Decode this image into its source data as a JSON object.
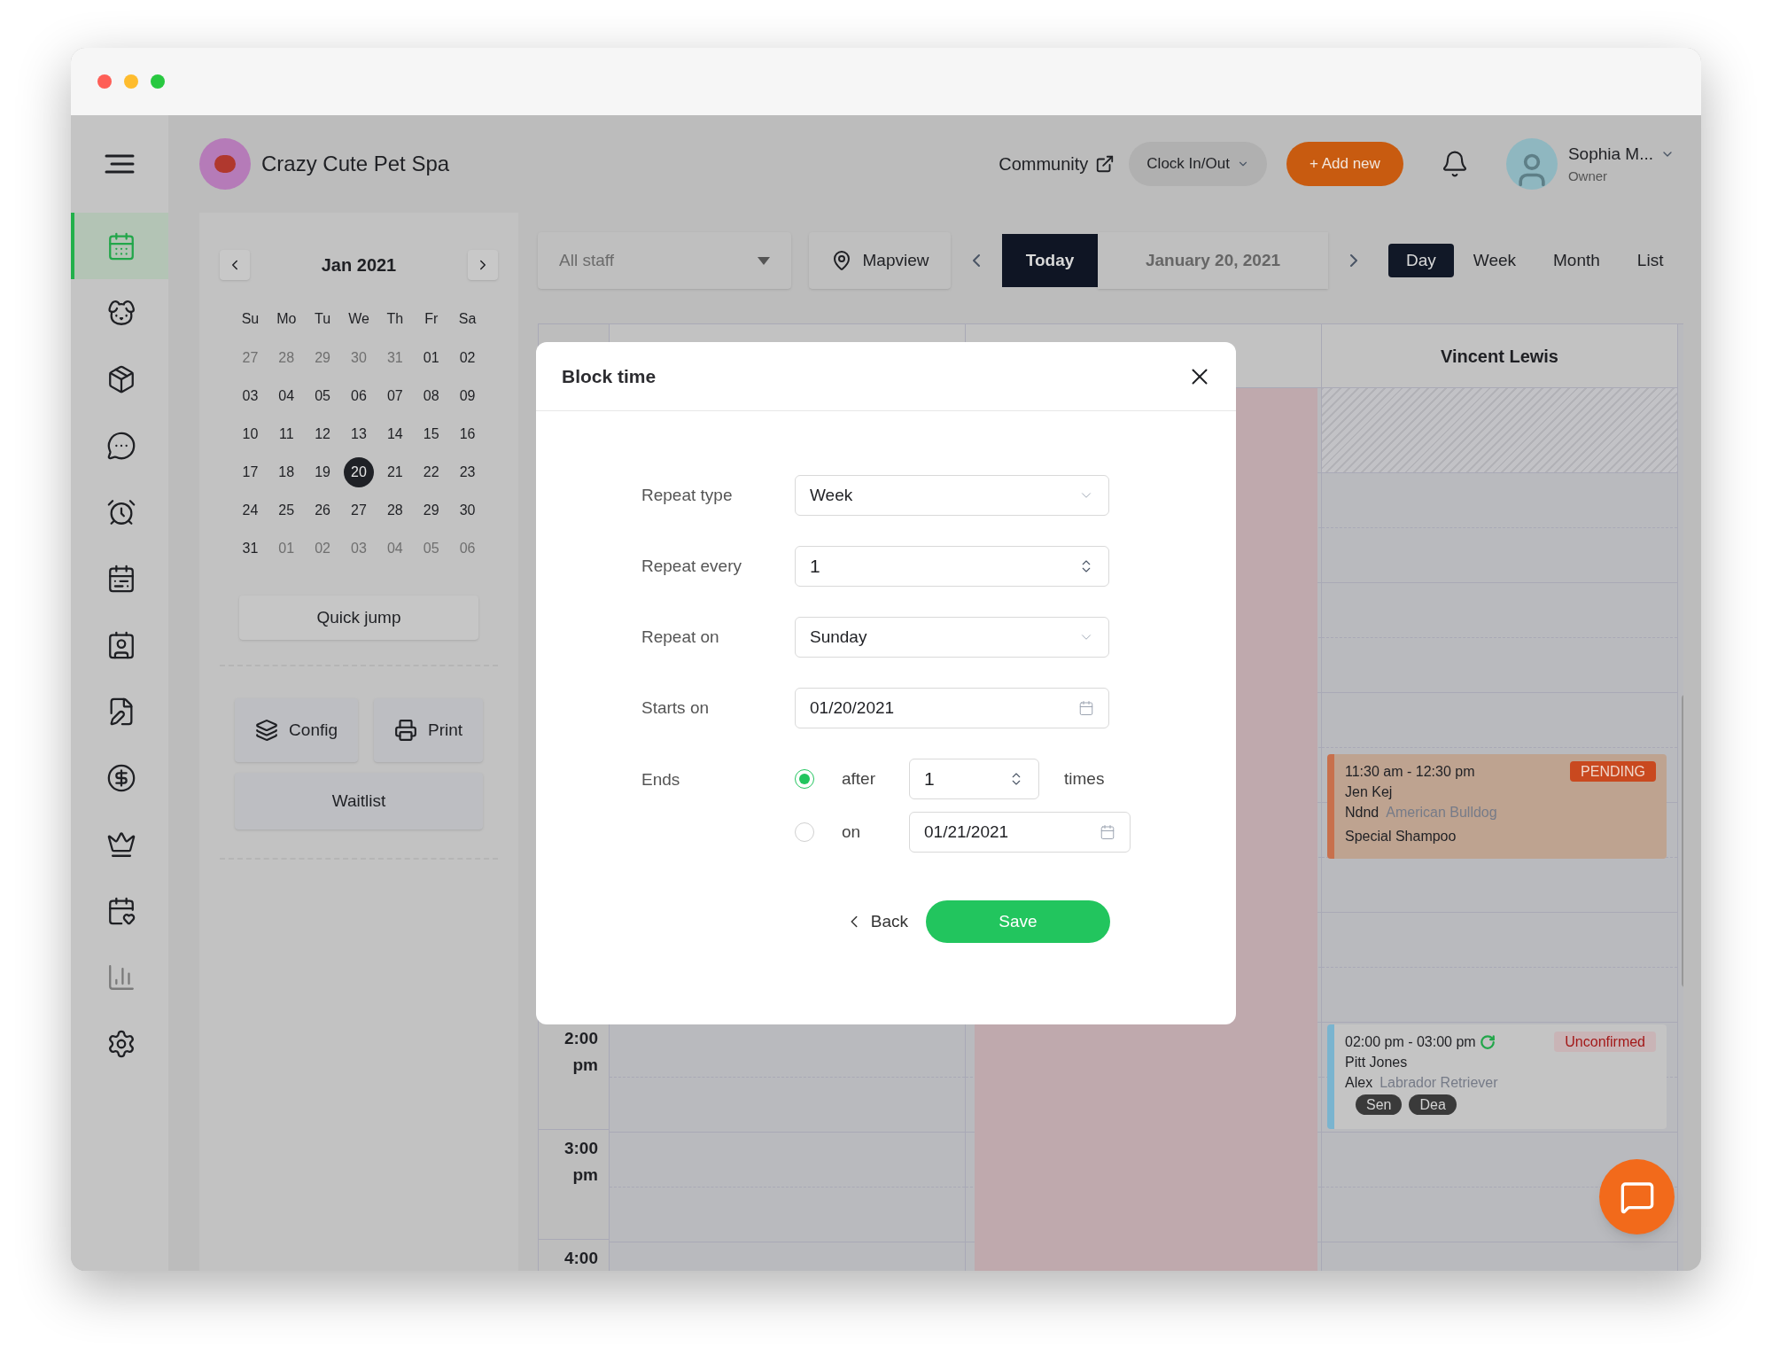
{
  "header": {
    "business_name": "Crazy Cute Pet Spa",
    "community_link": "Community",
    "clock_button": "Clock In/Out",
    "add_button": "+ Add new",
    "user": {
      "name": "Sophia M...",
      "role": "Owner"
    }
  },
  "sidebar": {
    "items": [
      {
        "selected": true,
        "disabled": false
      },
      {
        "selected": false,
        "disabled": false
      },
      {
        "selected": false,
        "disabled": false
      },
      {
        "selected": false,
        "disabled": false
      },
      {
        "selected": false,
        "disabled": false
      },
      {
        "selected": false,
        "disabled": false
      },
      {
        "selected": false,
        "disabled": false
      },
      {
        "selected": false,
        "disabled": false
      },
      {
        "selected": false,
        "disabled": false
      },
      {
        "selected": false,
        "disabled": false
      },
      {
        "selected": false,
        "disabled": false
      },
      {
        "selected": false,
        "disabled": true
      },
      {
        "selected": false,
        "disabled": false
      }
    ]
  },
  "mini_calendar": {
    "title": "Jan 2021",
    "weekdays": [
      "Su",
      "Mo",
      "Tu",
      "We",
      "Th",
      "Fr",
      "Sa"
    ],
    "weeks": [
      [
        {
          "label": "27",
          "in_month": false,
          "selected": false
        },
        {
          "label": "28",
          "in_month": false,
          "selected": false
        },
        {
          "label": "29",
          "in_month": false,
          "selected": false
        },
        {
          "label": "30",
          "in_month": false,
          "selected": false
        },
        {
          "label": "31",
          "in_month": false,
          "selected": false
        },
        {
          "label": "01",
          "in_month": true,
          "selected": false
        },
        {
          "label": "02",
          "in_month": true,
          "selected": false
        }
      ],
      [
        {
          "label": "03",
          "in_month": true,
          "selected": false
        },
        {
          "label": "04",
          "in_month": true,
          "selected": false
        },
        {
          "label": "05",
          "in_month": true,
          "selected": false
        },
        {
          "label": "06",
          "in_month": true,
          "selected": false
        },
        {
          "label": "07",
          "in_month": true,
          "selected": false
        },
        {
          "label": "08",
          "in_month": true,
          "selected": false
        },
        {
          "label": "09",
          "in_month": true,
          "selected": false
        }
      ],
      [
        {
          "label": "10",
          "in_month": true,
          "selected": false
        },
        {
          "label": "11",
          "in_month": true,
          "selected": false
        },
        {
          "label": "12",
          "in_month": true,
          "selected": false
        },
        {
          "label": "13",
          "in_month": true,
          "selected": false
        },
        {
          "label": "14",
          "in_month": true,
          "selected": false
        },
        {
          "label": "15",
          "in_month": true,
          "selected": false
        },
        {
          "label": "16",
          "in_month": true,
          "selected": false
        }
      ],
      [
        {
          "label": "17",
          "in_month": true,
          "selected": false
        },
        {
          "label": "18",
          "in_month": true,
          "selected": false
        },
        {
          "label": "19",
          "in_month": true,
          "selected": false
        },
        {
          "label": "20",
          "in_month": true,
          "selected": true
        },
        {
          "label": "21",
          "in_month": true,
          "selected": false
        },
        {
          "label": "22",
          "in_month": true,
          "selected": false
        },
        {
          "label": "23",
          "in_month": true,
          "selected": false
        }
      ],
      [
        {
          "label": "24",
          "in_month": true,
          "selected": false
        },
        {
          "label": "25",
          "in_month": true,
          "selected": false
        },
        {
          "label": "26",
          "in_month": true,
          "selected": false
        },
        {
          "label": "27",
          "in_month": true,
          "selected": false
        },
        {
          "label": "28",
          "in_month": true,
          "selected": false
        },
        {
          "label": "29",
          "in_month": true,
          "selected": false
        },
        {
          "label": "30",
          "in_month": true,
          "selected": false
        }
      ],
      [
        {
          "label": "31",
          "in_month": true,
          "selected": false
        },
        {
          "label": "01",
          "in_month": false,
          "selected": false
        },
        {
          "label": "02",
          "in_month": false,
          "selected": false
        },
        {
          "label": "03",
          "in_month": false,
          "selected": false
        },
        {
          "label": "04",
          "in_month": false,
          "selected": false
        },
        {
          "label": "05",
          "in_month": false,
          "selected": false
        },
        {
          "label": "06",
          "in_month": false,
          "selected": false
        }
      ]
    ],
    "quick_jump": "Quick jump",
    "config": "Config",
    "print": "Print",
    "waitlist": "Waitlist"
  },
  "toolbar": {
    "staff_select": "All staff",
    "mapview": "Mapview",
    "today": "Today",
    "date": "January 20, 2021",
    "views": [
      {
        "label": "Day",
        "selected": true
      },
      {
        "label": "Week",
        "selected": false
      },
      {
        "label": "Month",
        "selected": false
      },
      {
        "label": "List",
        "selected": false
      }
    ]
  },
  "calendar": {
    "columns": [
      {
        "blocked": false
      },
      {
        "blocked": true
      },
      {
        "name": "Vincent Lewis",
        "blocked": false
      }
    ],
    "time_labels": [
      {
        "hour": "2:00",
        "period": "pm"
      },
      {
        "hour": "3:00",
        "period": "pm"
      },
      {
        "hour": "4:00"
      }
    ],
    "appointments": [
      {
        "time": "11:30 am - 12:30 pm",
        "status": "PENDING",
        "kind": "pending",
        "repeat": false,
        "client": "Jen Kej",
        "pet": "Ndnd",
        "breed": "American Bulldog",
        "service": "Special Shampoo"
      },
      {
        "time": "02:00 pm - 03:00 pm",
        "status": "Unconfirmed",
        "kind": "unconfirmed",
        "repeat": true,
        "client": "Pitt Jones",
        "pet": "Alex",
        "breed": "Labrador Retriever",
        "tags": [
          "Sen",
          "Dea"
        ]
      }
    ]
  },
  "modal": {
    "title": "Block time",
    "fields": [
      {
        "kind": "select",
        "label": "Repeat type",
        "value": "Week"
      },
      {
        "kind": "number",
        "label": "Repeat every",
        "value": "1"
      },
      {
        "kind": "select",
        "label": "Repeat on",
        "value": "Sunday"
      },
      {
        "kind": "date",
        "label": "Starts on",
        "value": "01/20/2021"
      }
    ],
    "ends": {
      "label": "Ends",
      "options": [
        {
          "label": "after",
          "selected": true,
          "kind": "number",
          "value": "1",
          "suffix": "times"
        },
        {
          "label": "on",
          "selected": false,
          "kind": "date",
          "value": "01/21/2021"
        }
      ]
    },
    "back": "Back",
    "save": "Save"
  }
}
